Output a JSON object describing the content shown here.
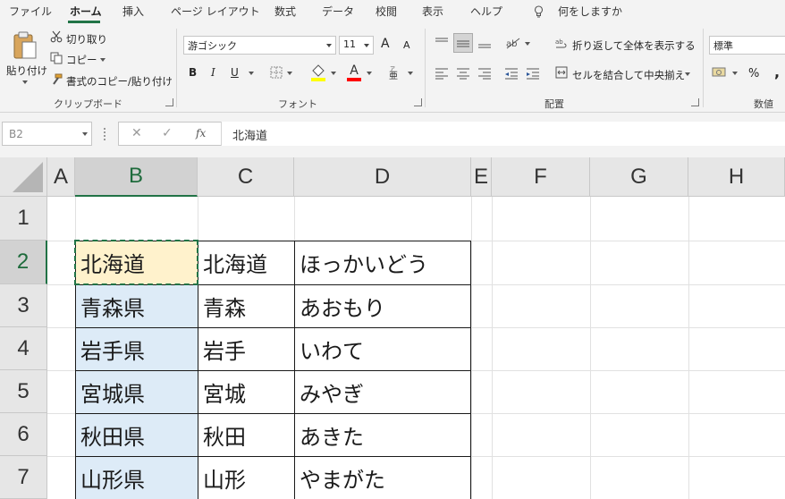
{
  "ribbon_tabs": [
    "ファイル",
    "ホーム",
    "挿入",
    "ページ レイアウト",
    "数式",
    "データ",
    "校閲",
    "表示",
    "ヘルプ"
  ],
  "tell_me": "何をしますか",
  "clipboard": {
    "paste": "貼り付け",
    "cut": "切り取り",
    "copy": "コピー",
    "format_painter": "書式のコピー/貼り付け",
    "label": "クリップボード"
  },
  "font": {
    "name": "游ゴシック",
    "size": "11",
    "bold": "B",
    "italic": "I",
    "underline": "U",
    "font_color_letter": "A",
    "grow": "A",
    "shrink": "A",
    "label": "フォント"
  },
  "alignment": {
    "wrap_text": "折り返して全体を表示する",
    "merge_center": "セルを結合して中央揃え",
    "label": "配置"
  },
  "number": {
    "format": "標準",
    "percent": "%",
    "comma": ",",
    "label": "数値"
  },
  "formula_bar": {
    "name_box": "B2",
    "cancel": "✕",
    "enter": "✓",
    "fx": "fx",
    "content": "北海道"
  },
  "columns": [
    "A",
    "B",
    "C",
    "D",
    "E",
    "F",
    "G",
    "H"
  ],
  "rows": [
    "1",
    "2",
    "3",
    "4",
    "5",
    "6",
    "7"
  ],
  "table": [
    {
      "b": "北海道",
      "c": "北海道",
      "d": "ほっかいどう"
    },
    {
      "b": "青森県",
      "c": "青森",
      "d": "あおもり"
    },
    {
      "b": "岩手県",
      "c": "岩手",
      "d": "いわて"
    },
    {
      "b": "宮城県",
      "c": "宮城",
      "d": "みやぎ"
    },
    {
      "b": "秋田県",
      "c": "秋田",
      "d": "あきた"
    },
    {
      "b": "山形県",
      "c": "山形",
      "d": "やまがた"
    }
  ],
  "colors": {
    "accent": "#217346",
    "active_cell_fill": "#fff2cc",
    "column_b_fill": "#ddebf7",
    "highlight_yellow": "#ffff00",
    "font_red": "#ff0000"
  }
}
